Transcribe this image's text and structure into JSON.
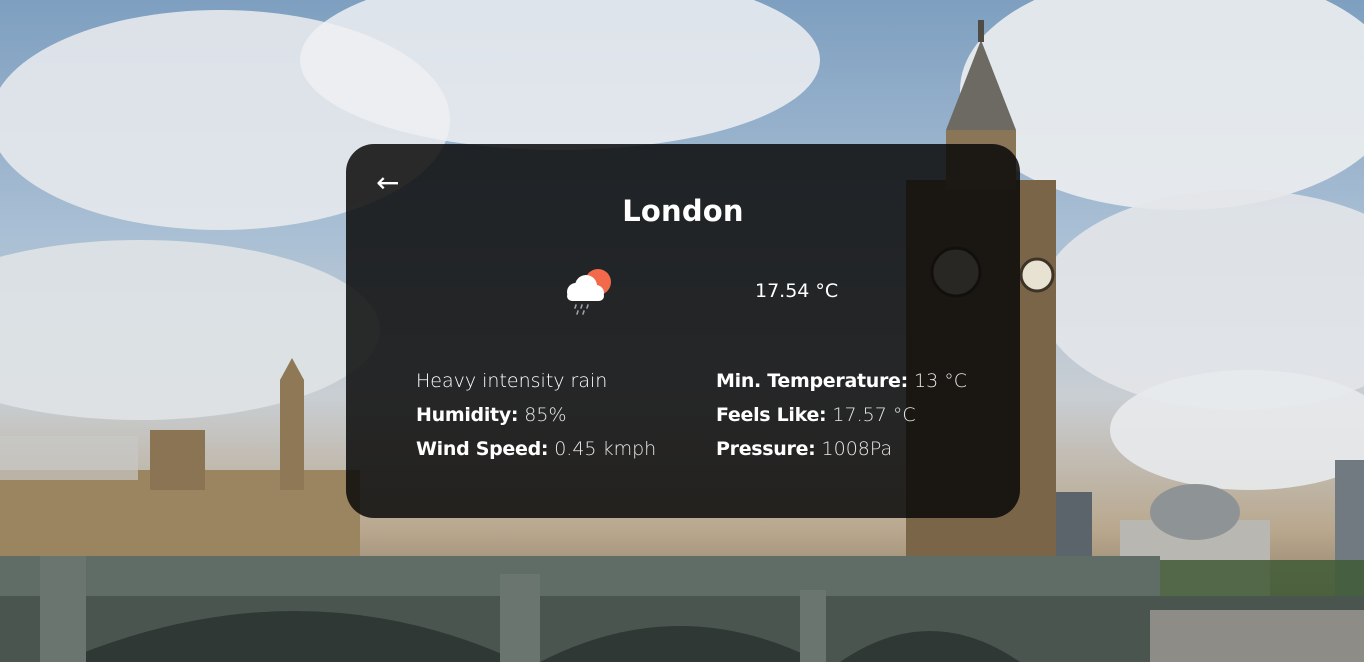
{
  "colors": {
    "card_background": "#0a0a0a",
    "text": "#ffffff",
    "sun": "#f26a4b",
    "cloud": "#ffffff"
  },
  "icons": {
    "back": "left-arrow-icon",
    "weather": "rain-cloud-sun-icon"
  },
  "back_arrow": "←",
  "city": "London",
  "temperature": "17.54 °C",
  "description": "Heavy intensity rain",
  "humidity": {
    "label": "Humidity:",
    "value": "85%"
  },
  "wind_speed": {
    "label": "Wind Speed:",
    "value": "0.45 kmph"
  },
  "min_temperature": {
    "label": "Min. Temperature:",
    "value": "13 °C"
  },
  "feels_like": {
    "label": "Feels Like:",
    "value": "17.57 °C"
  },
  "pressure": {
    "label": "Pressure:",
    "value": "1008Pa"
  }
}
